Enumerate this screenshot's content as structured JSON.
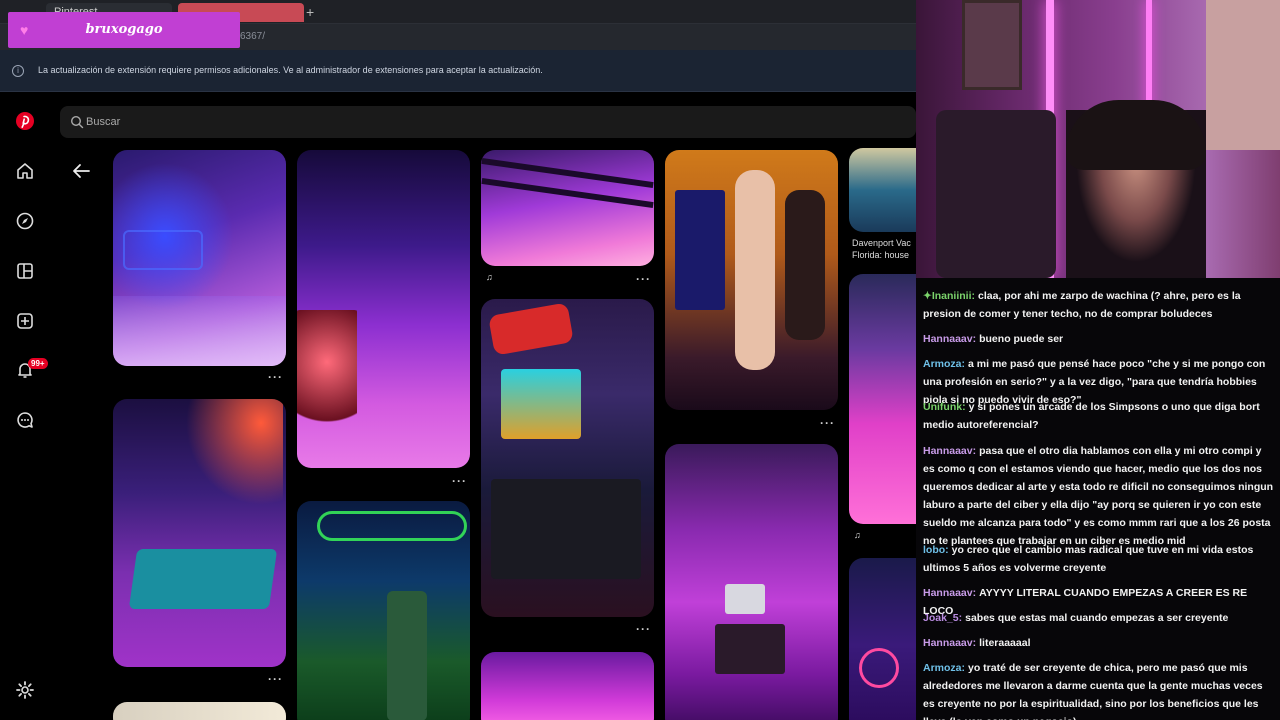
{
  "overlay": {
    "streamer_name": "bruxogago"
  },
  "browser": {
    "tabs": [
      {
        "label": "Pinterest"
      },
      {
        "label": ""
      }
    ],
    "url_fragment": "6367/"
  },
  "notice": {
    "text": "La actualización de extensión requiere permisos adicionales. Ve al administrador de extensiones para aceptar la actualización."
  },
  "pinterest": {
    "search": {
      "placeholder": "Buscar"
    },
    "notification_badge": "99+",
    "pin_label": "Davenport Vac Florida: house"
  },
  "chat": {
    "messages": [
      {
        "user": "Inaniinii:",
        "color": "#7bd36b",
        "text": "claa, por ahi me zarpo de wachina (? ahre, pero es la presion de comer y tener techo, no de comprar boludeces"
      },
      {
        "user": "Hannaaav:",
        "color": "#c89be8",
        "text": "bueno puede ser"
      },
      {
        "user": "Armoza:",
        "color": "#6fc0e8",
        "text": "a mi me pasó que pensé hace poco \"che y si me pongo con una profesión en serio?\" y a la vez digo, \"para que tendría hobbies piola si no puedo vivir de eso?\""
      },
      {
        "user": "Unifunk:",
        "color": "#7bd36b",
        "text": "y si pones un arcade de los Simpsons o uno que diga bort medio autoreferencial?"
      },
      {
        "user": "Hannaaav:",
        "color": "#c89be8",
        "text": "pasa que el otro dia hablamos con ella y mi otro compi y es como q con el estamos viendo que hacer, medio que los dos nos queremos dedicar al arte y esta todo re dificil no conseguimos ningun laburo a parte del ciber y ella dijo \"ay porq se quieren ir yo con este sueldo me alcanza para todo\" y es como mmm rari que a los 26 posta no te plantees que trabajar en un ciber es medio mid"
      },
      {
        "user": "lobo:",
        "color": "#6fc0e8",
        "text": "yo creo que el cambio mas radical que tuve en mi vida estos ultimos 5 años es volverme creyente"
      },
      {
        "user": "Hannaaav:",
        "color": "#c89be8",
        "text": "AYYYY LITERAL CUANDO EMPEZAS A CREER ES RE LOCO"
      },
      {
        "user": "Joak_5:",
        "color": "#b98be0",
        "text": "sabes que estas mal cuando empezas a ser creyente"
      },
      {
        "user": "Hannaaav:",
        "color": "#c89be8",
        "text": "literaaaaal"
      },
      {
        "user": "Armoza:",
        "color": "#6fc0e8",
        "text": "yo traté de ser creyente de chica, pero me pasó que mis alrededores me llevaron a darme cuenta que la gente muchas veces es creyente no por la espiritualidad, sino por los beneficios que les lleva (lo ven como un negocio)"
      }
    ]
  }
}
